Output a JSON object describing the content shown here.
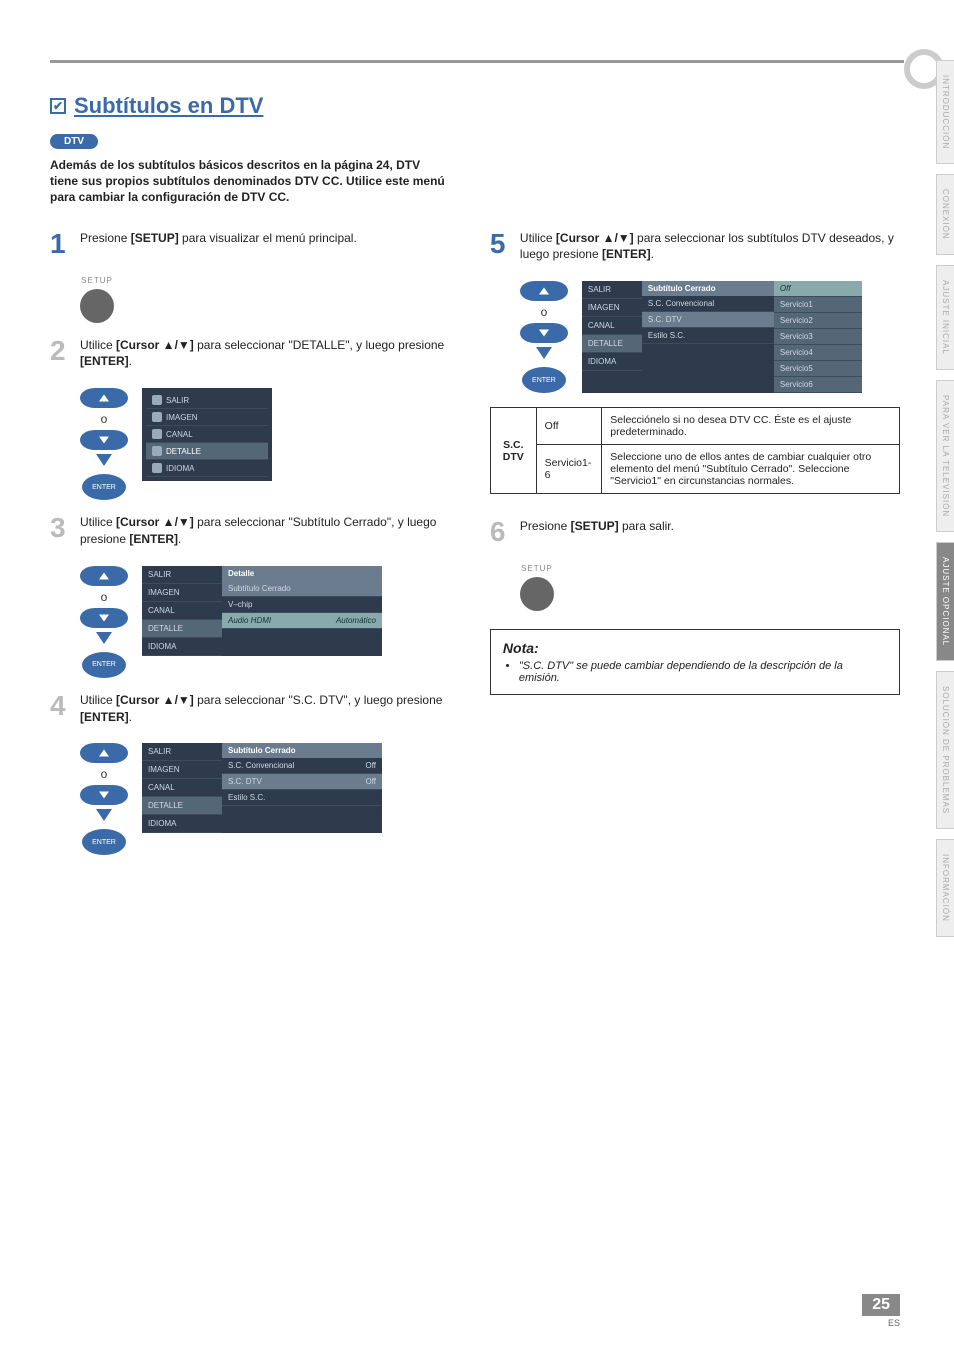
{
  "header": {
    "title": "Subtítulos en DTV",
    "badge": "DTV"
  },
  "intro": "Además de los subtítulos básicos descritos en la página 24, DTV tiene sus propios subtítulos denominados DTV CC. Utilice este menú para cambiar la configuración de DTV CC.",
  "setup_label": "SETUP",
  "enter_label": "ENTER",
  "o_label": "o",
  "steps": {
    "s1": {
      "num": "1",
      "pre": "Presione ",
      "bold": "[SETUP]",
      "post": " para visualizar el menú principal."
    },
    "s2": {
      "num": "2",
      "pre": "Utilice ",
      "bold": "[Cursor ▲/▼]",
      "mid": " para seleccionar \"DETALLE\", y luego presione ",
      "bold2": "[ENTER]",
      "post": "."
    },
    "s3": {
      "num": "3",
      "pre": "Utilice ",
      "bold": "[Cursor ▲/▼]",
      "mid": " para seleccionar \"Subtítulo Cerrado\", y luego presione ",
      "bold2": "[ENTER]",
      "post": "."
    },
    "s4": {
      "num": "4",
      "pre": "Utilice ",
      "bold": "[Cursor ▲/▼]",
      "mid": " para seleccionar \"S.C. DTV\", y luego presione ",
      "bold2": "[ENTER]",
      "post": "."
    },
    "s5": {
      "num": "5",
      "pre": "Utilice ",
      "bold": "[Cursor ▲/▼]",
      "mid": " para seleccionar los subtítulos DTV deseados, y luego presione ",
      "bold2": "[ENTER]",
      "post": "."
    },
    "s6": {
      "num": "6",
      "pre": "Presione ",
      "bold": "[SETUP]",
      "post": " para salir."
    }
  },
  "menu_side": {
    "items": [
      "SALIR",
      "IMAGEN",
      "CANAL",
      "DETALLE",
      "IDIOMA"
    ]
  },
  "panel3": {
    "header": "Detalle",
    "rows": [
      {
        "l": "Subtítulo Cerrado",
        "r": ""
      },
      {
        "l": "V–chip",
        "r": ""
      },
      {
        "l": "Audio HDMI",
        "r": "Automático"
      }
    ]
  },
  "panel4": {
    "header": "Subtítulo Cerrado",
    "rows": [
      {
        "l": "S.C. Convencional",
        "r": "Off"
      },
      {
        "l": "S.C. DTV",
        "r": "Off"
      },
      {
        "l": "Estilo S.C.",
        "r": ""
      }
    ]
  },
  "panel5": {
    "header": "Subtítulo Cerrado",
    "left": [
      {
        "l": "S.C. Convencional",
        "r": ""
      },
      {
        "l": "S.C. DTV",
        "r": ""
      },
      {
        "l": "Estilo S.C.",
        "r": ""
      }
    ],
    "options": [
      "Off",
      "Servicio1",
      "Servicio2",
      "Servicio3",
      "Servicio4",
      "Servicio5",
      "Servicio6"
    ]
  },
  "spec": {
    "rowhead": "S.C. DTV",
    "r1": {
      "k": "Off",
      "v": "Selecciónelo si no desea DTV CC. Éste es el ajuste predeterminado."
    },
    "r2": {
      "k": "Servicio1-6",
      "v": "Seleccione uno de ellos antes de cambiar cualquier otro elemento del menú \"Subtítulo Cerrado\". Seleccione \"Servicio1\" en circunstancias normales."
    }
  },
  "nota": {
    "title": "Nota:",
    "li1": "\"S.C. DTV\" se puede cambiar dependiendo de la descripción de la emisión."
  },
  "tabs": [
    "INTRODUCCIÓN",
    "CONEXIÓN",
    "AJUSTE INICIAL",
    "PARA VER LA TELEVISIÓN",
    "AJUSTE OPCIONAL",
    "SOLUCIÓN DE PROBLEMAS",
    "INFORMACIÓN"
  ],
  "page": {
    "num": "25",
    "es": "ES"
  }
}
